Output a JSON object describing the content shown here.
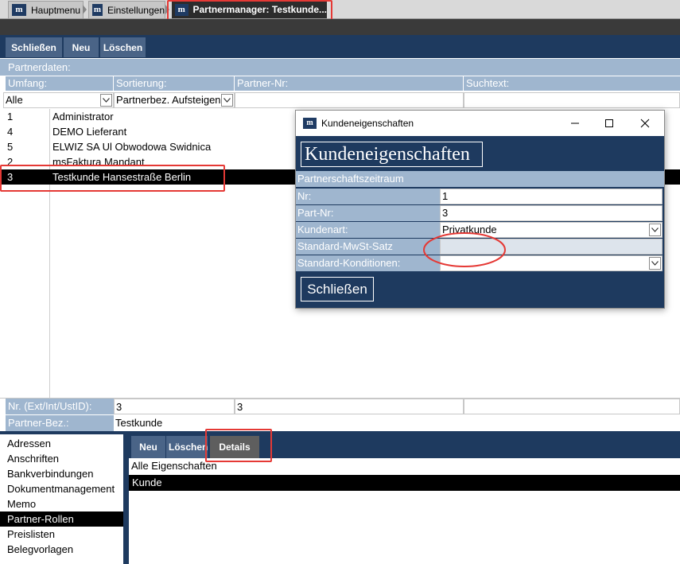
{
  "tabs": [
    {
      "label": "Hauptmenu"
    },
    {
      "label": "Einstellungen"
    },
    {
      "label": "Partnermanager: Testkunde..."
    }
  ],
  "toolbar": {
    "close_label": "Schließen",
    "new_label": "Neu",
    "delete_label": "Löschen"
  },
  "section": {
    "title": "Partnerdaten:"
  },
  "filters": {
    "scope_label": "Umfang:",
    "sort_label": "Sortierung:",
    "partner_no_label": "Partner-Nr:",
    "search_label": "Suchtext:",
    "scope_value": "Alle",
    "sort_value": "Partnerbez. Aufsteigend",
    "partner_no_value": "",
    "search_value": ""
  },
  "partners": [
    {
      "id": "1",
      "name": "Administrator"
    },
    {
      "id": "4",
      "name": "DEMO Lieferant"
    },
    {
      "id": "5",
      "name": "ELWIZ SA Ul Obwodowa Swidnica"
    },
    {
      "id": "2",
      "name": "msFaktura Mandant"
    },
    {
      "id": "3",
      "name": "Testkunde Hansestraße Berlin"
    }
  ],
  "details": {
    "nr_label": "Nr. (Ext/Int/UstID):",
    "nr_ext": "3",
    "nr_int": "3",
    "nr_ustid": "",
    "bez_label": "Partner-Bez.:",
    "bez_value": "Testkunde"
  },
  "nav": [
    {
      "label": "Adressen"
    },
    {
      "label": "Anschriften"
    },
    {
      "label": "Bankverbindungen"
    },
    {
      "label": "Dokumentmanagement"
    },
    {
      "label": "Memo"
    },
    {
      "label": "Partner-Rollen"
    },
    {
      "label": "Preislisten"
    },
    {
      "label": "Belegvorlagen"
    }
  ],
  "roles_toolbar": {
    "new_label": "Neu",
    "delete_label": "Löschen",
    "details_label": "Details"
  },
  "roles": {
    "header": "Alle Eigenschaften",
    "items": [
      {
        "label": "Kunde"
      }
    ]
  },
  "dialog": {
    "window_title": "Kundeneigenschaften",
    "heading": "Kundeneigenschaften",
    "section": "Partnerschaftszeitraum",
    "fields": [
      {
        "label": "Nr:",
        "value": "1"
      },
      {
        "label": "Part-Nr:",
        "value": "3"
      },
      {
        "label": "Kundenart:",
        "value": "Privatkunde"
      },
      {
        "label": "Standard-MwSt-Satz",
        "value": ""
      },
      {
        "label": "Standard-Konditionen:",
        "value": ""
      }
    ],
    "close_label": "Schließen"
  },
  "colors": {
    "navy": "#1e3a5f",
    "header_blue": "#9fb6cf",
    "button_blue": "#4a6487",
    "highlight_red": "#e53935"
  }
}
